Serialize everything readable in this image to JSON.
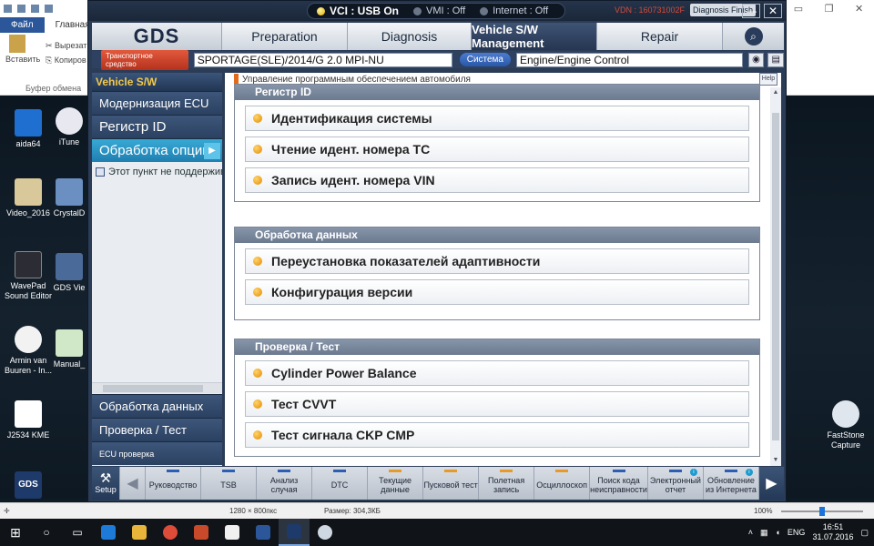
{
  "background_app": {
    "tab_file": "Файл",
    "tab_main": "Главная",
    "paste_label": "Вставить",
    "cut_label": "Вырезат",
    "copy_label": "Копиров",
    "clipboard_group": "Буфер обмена"
  },
  "desktop_icons": [
    "aida64",
    "iTune",
    "Video_2016",
    "CrystalD",
    "WavePad Sound Editor",
    "GDS Vie",
    "Armin van Buuren - In...",
    "Manual_",
    "J2534 KME",
    "GDS",
    "FastStone Capture"
  ],
  "gds": {
    "status": {
      "vci": "VCI : USB On",
      "vmi": "VMI : Off",
      "internet": "Internet : Off",
      "vdn": "VDN : 160731002F",
      "diag_finish": "Diagnosis Finish"
    },
    "logo": "GDS",
    "nav_tabs": [
      "Preparation",
      "Diagnosis",
      "Vehicle S/W Management",
      "Repair"
    ],
    "vehicle_row": {
      "tag": "Транспортное средство",
      "vehicle": "SPORTAGE(SLE)/2014/G 2.0 MPI-NU",
      "system_btn": "Система",
      "system": "Engine/Engine Control"
    },
    "sidebar": {
      "title": "Vehicle S/W Management",
      "items": [
        "Модернизация ECU",
        "Регистр ID",
        "Обработка опции"
      ],
      "note": "Этот пункт не поддерживается",
      "bottom_items": [
        "Обработка данных",
        "Проверка / Тест",
        "ECU проверка картографирования"
      ]
    },
    "content": {
      "breadcrumb": "Управление программным обеспечением автомобиля",
      "help": "Help",
      "sections": [
        {
          "title": "Регистр ID",
          "items": [
            "Идентификация системы",
            "Чтение идент. номера ТС",
            "Запись идент. номера VIN"
          ]
        },
        {
          "title": "Обработка данных",
          "items": [
            "Переустановка показателей адаптивности",
            "Конфигурация версии"
          ]
        },
        {
          "title": "Проверка / Тест",
          "items": [
            "Cylinder Power Balance",
            "Тест CVVT",
            "Тест сигнала CKP CMP"
          ]
        }
      ]
    },
    "toolbar": {
      "setup": "Setup",
      "items": [
        "Руководство",
        "TSB",
        "Анализ случая",
        "DTC",
        "Текущие данные",
        "Пусковой тест",
        "Полетная запись",
        "Осциллоскоп",
        "Поиск кода неисправности",
        "Электронный отчет",
        "Обновление из Интернета"
      ]
    }
  },
  "viewer_bar": {
    "dimensions": "1280 × 800пкс",
    "size": "Размер: 304,3КБ",
    "zoom": "100%"
  },
  "taskbar": {
    "lang": "ENG",
    "time": "16:51",
    "date": "31.07.2016"
  }
}
